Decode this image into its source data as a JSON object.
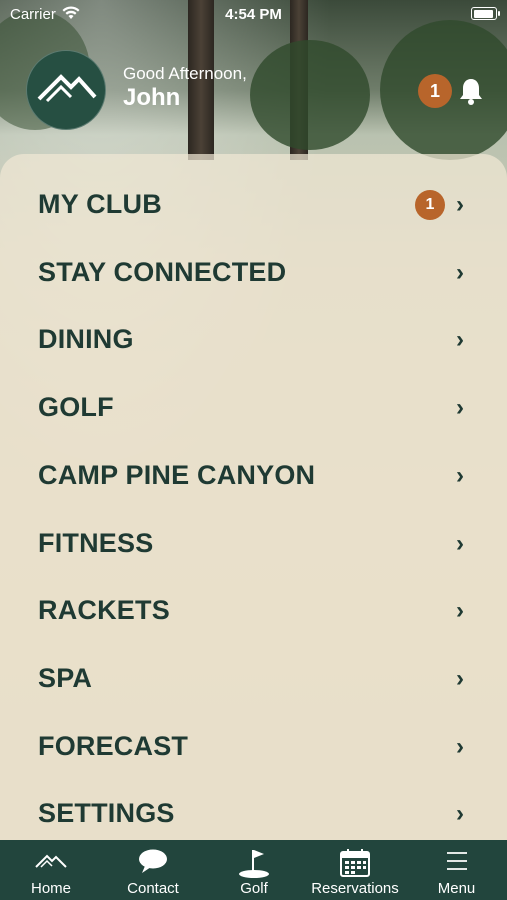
{
  "status_bar": {
    "carrier": "Carrier",
    "time": "4:54 PM"
  },
  "header": {
    "greeting": "Good Afternoon,",
    "user_name": "John",
    "notification_count": "1"
  },
  "menu": {
    "items": [
      {
        "label": "MY CLUB",
        "badge": "1"
      },
      {
        "label": "STAY CONNECTED"
      },
      {
        "label": "DINING"
      },
      {
        "label": "GOLF"
      },
      {
        "label": "CAMP PINE CANYON"
      },
      {
        "label": "FITNESS"
      },
      {
        "label": "RACKETS"
      },
      {
        "label": "SPA"
      },
      {
        "label": "FORECAST"
      },
      {
        "label": "SETTINGS"
      }
    ]
  },
  "tabbar": {
    "tabs": [
      {
        "label": "Home",
        "icon": "mountain-icon"
      },
      {
        "label": "Contact",
        "icon": "chat-bubble-icon"
      },
      {
        "label": "Golf",
        "icon": "golf-flag-icon"
      },
      {
        "label": "Reservations",
        "icon": "calendar-icon"
      },
      {
        "label": "Menu",
        "icon": "hamburger-menu-icon"
      }
    ]
  },
  "colors": {
    "brand_green": "#22453d",
    "text_dark_green": "#1f3a33",
    "badge_orange": "#b8652b"
  }
}
